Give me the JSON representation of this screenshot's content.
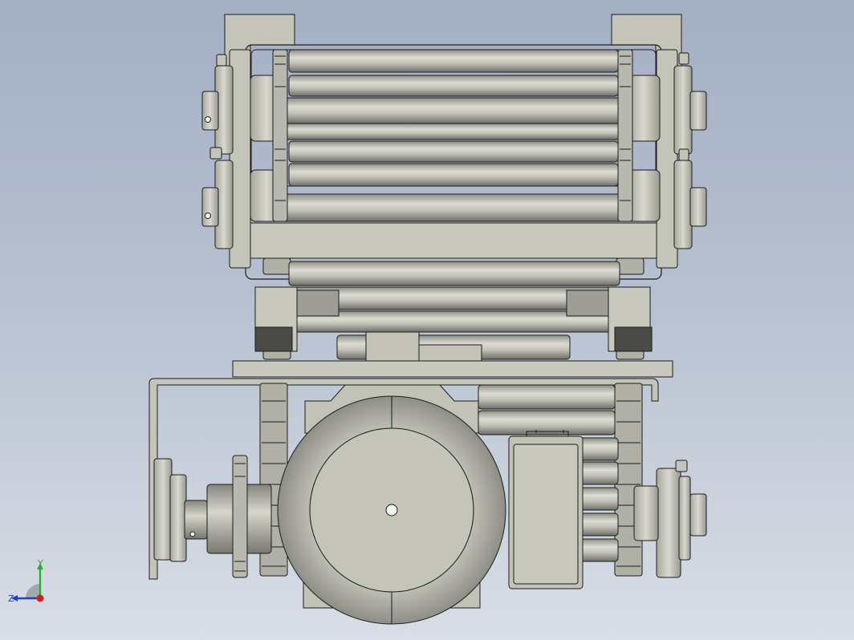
{
  "viewport": {
    "background_top": "#a3afc4",
    "background_bottom": "#d9dee6",
    "part_color": "#c4c4b8",
    "edge_color": "#1c1c1c"
  },
  "triad": {
    "y_label": "Y",
    "z_label": "Z",
    "y_color": "#1fb81f",
    "z_color": "#1f3fd6",
    "x_color": "#d11f1f"
  }
}
